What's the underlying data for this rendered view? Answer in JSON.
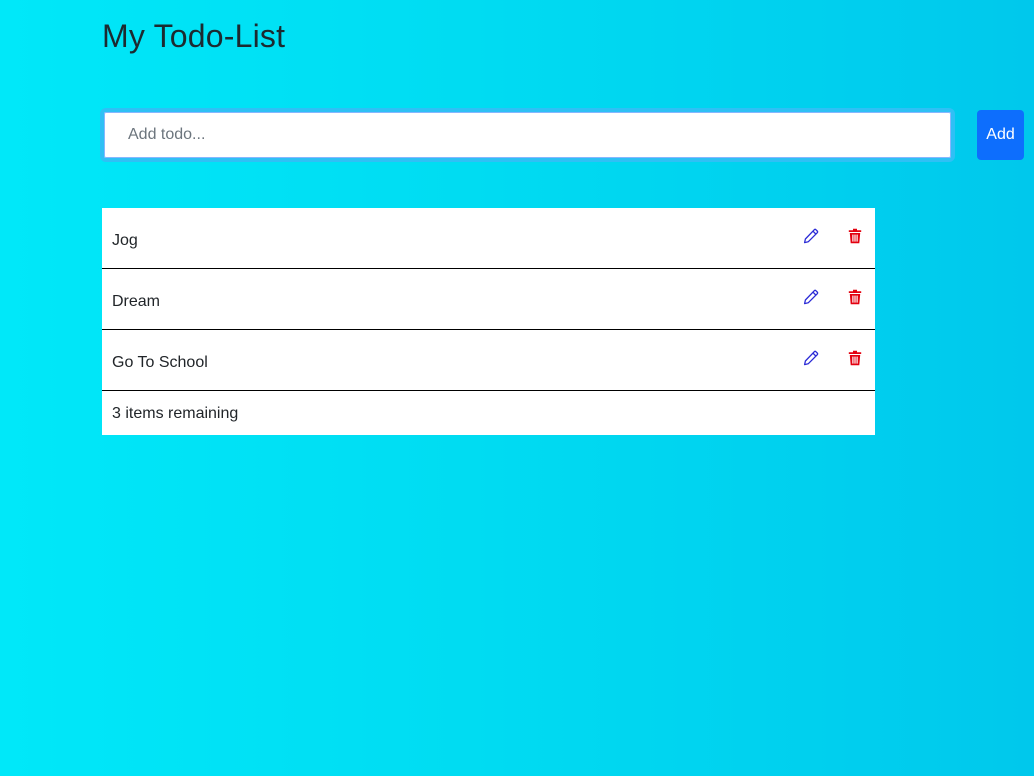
{
  "header": {
    "title": "My Todo-List"
  },
  "form": {
    "placeholder": "Add todo...",
    "value": "",
    "add_label": "Add"
  },
  "todos": [
    {
      "text": "Jog",
      "edit_icon": "pencil-icon",
      "delete_icon": "trash-icon"
    },
    {
      "text": "Dream",
      "edit_icon": "pencil-icon",
      "delete_icon": "trash-icon"
    },
    {
      "text": "Go To School",
      "edit_icon": "pencil-icon",
      "delete_icon": "trash-icon"
    }
  ],
  "footer": {
    "remaining": "3 items remaining"
  },
  "colors": {
    "background_start": "#00e8f9",
    "background_end": "#00c8ec",
    "accent": "#0d6efd",
    "edit_icon": "#2b2bd6",
    "delete_icon": "#e3000f"
  }
}
